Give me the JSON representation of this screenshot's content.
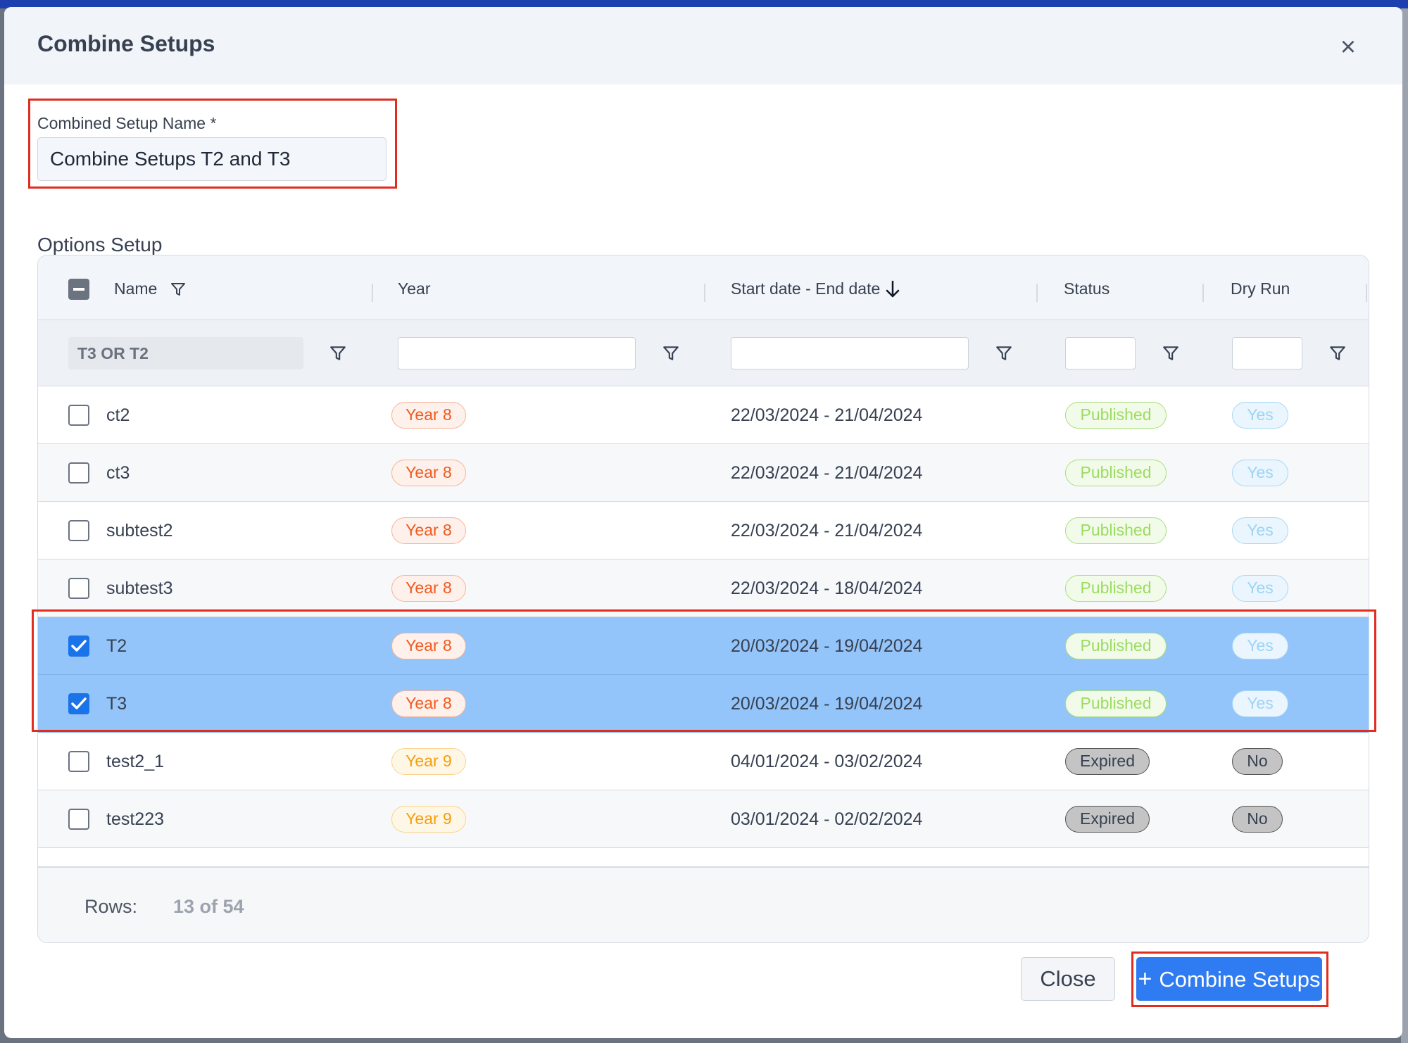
{
  "dialog": {
    "title": "Combine Setups",
    "close_icon": "close-icon"
  },
  "form": {
    "name_label": "Combined Setup Name *",
    "name_value": "Combine Setups T2 and T3",
    "section_label": "Options Setup"
  },
  "table": {
    "columns": [
      {
        "label": "Name",
        "icon": "filter-icon"
      },
      {
        "label": "Year"
      },
      {
        "label": "Start date - End date",
        "icon": "sort-desc-arrow-icon"
      },
      {
        "label": "Status"
      },
      {
        "label": "Dry Run"
      }
    ],
    "filters": {
      "name": "T3 OR T2",
      "year": "",
      "dates": "",
      "status": "",
      "dry_run": ""
    },
    "rows": [
      {
        "name": "ct2",
        "year": "Year 8",
        "dates": "22/03/2024 - 21/04/2024",
        "status": "Published",
        "dry_run": "Yes",
        "checked": false
      },
      {
        "name": "ct3",
        "year": "Year 8",
        "dates": "22/03/2024 - 21/04/2024",
        "status": "Published",
        "dry_run": "Yes",
        "checked": false
      },
      {
        "name": "subtest2",
        "year": "Year 8",
        "dates": "22/03/2024 - 21/04/2024",
        "status": "Published",
        "dry_run": "Yes",
        "checked": false
      },
      {
        "name": "subtest3",
        "year": "Year 8",
        "dates": "22/03/2024 - 18/04/2024",
        "status": "Published",
        "dry_run": "Yes",
        "checked": false
      },
      {
        "name": "T2",
        "year": "Year 8",
        "dates": "20/03/2024 - 19/04/2024",
        "status": "Published",
        "dry_run": "Yes",
        "checked": true
      },
      {
        "name": "T3",
        "year": "Year 8",
        "dates": "20/03/2024 - 19/04/2024",
        "status": "Published",
        "dry_run": "Yes",
        "checked": true
      },
      {
        "name": "test2_1",
        "year": "Year 9",
        "dates": "04/01/2024 - 03/02/2024",
        "status": "Expired",
        "dry_run": "No",
        "checked": false
      },
      {
        "name": "test223",
        "year": "Year 9",
        "dates": "03/01/2024 - 02/02/2024",
        "status": "Expired",
        "dry_run": "No",
        "checked": false
      }
    ],
    "footer": {
      "rows_label": "Rows:",
      "rows_value": "13 of 54"
    }
  },
  "buttons": {
    "close": "Close",
    "combine_plus": "+",
    "combine": "Combine Setups"
  },
  "colors": {
    "primary": "#2f7bf2",
    "selected_row": "#93c4fa",
    "highlight": "#e02d1f",
    "year8": "#f05a1f",
    "year9": "#f59e0b",
    "published": "#9bdc60",
    "yes": "#9dd4f5"
  }
}
